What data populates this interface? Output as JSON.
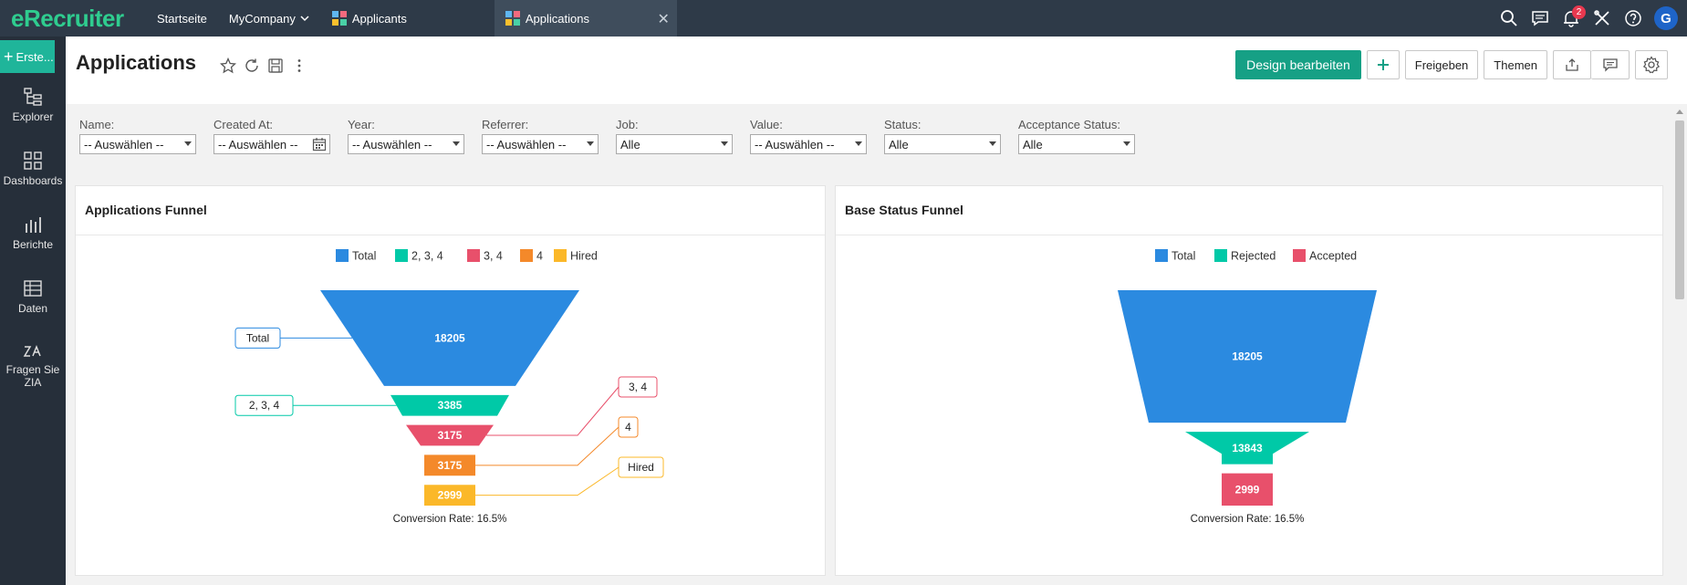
{
  "app": {
    "logo": "eRecruiter"
  },
  "topnav": {
    "home": "Startseite",
    "company": "MyCompany",
    "tabs": [
      {
        "label": "Applicants",
        "active": false
      },
      {
        "label": "Applications",
        "active": true
      }
    ],
    "notification_count": "2",
    "avatar_initial": "G"
  },
  "sidebar": {
    "create": "Erste...",
    "items": [
      {
        "label": "Explorer",
        "icon": "explorer-icon"
      },
      {
        "label": "Dashboards",
        "icon": "dashboards-icon"
      },
      {
        "label": "Berichte",
        "icon": "reports-icon"
      },
      {
        "label": "Daten",
        "icon": "data-table-icon"
      },
      {
        "label": "Fragen Sie ZIA",
        "icon": "zia-icon"
      }
    ]
  },
  "header": {
    "title": "Applications",
    "edit_design": "Design bearbeiten",
    "share": "Freigeben",
    "themes": "Themen"
  },
  "filters": [
    {
      "label": "Name:",
      "value": "-- Auswählen --"
    },
    {
      "label": "Created At:",
      "value": "-- Auswählen --"
    },
    {
      "label": "Year:",
      "value": "-- Auswählen --"
    },
    {
      "label": "Referrer:",
      "value": "-- Auswählen --"
    },
    {
      "label": "Job:",
      "value": "Alle"
    },
    {
      "label": "Value:",
      "value": "-- Auswählen --"
    },
    {
      "label": "Status:",
      "value": "Alle"
    },
    {
      "label": "Acceptance Status:",
      "value": "Alle"
    }
  ],
  "colors": {
    "blue": "#2b8ae0",
    "teal": "#00c9a7",
    "pink": "#e8506b",
    "orange": "#f4892a",
    "yellow": "#fbb829",
    "brand_green": "#2fcc8f",
    "primary_button": "#16a085"
  },
  "chart_data": [
    {
      "type": "funnel",
      "title": "Applications Funnel",
      "legend": [
        "Total",
        "2, 3, 4",
        "3, 4",
        "4",
        "Hired"
      ],
      "categories": [
        "Total",
        "2, 3, 4",
        "3, 4",
        "4",
        "Hired"
      ],
      "values": [
        18205,
        3385,
        3175,
        3175,
        2999
      ],
      "colors": [
        "#2b8ae0",
        "#00c9a7",
        "#e8506b",
        "#f4892a",
        "#fbb829"
      ],
      "conversion_rate": "Conversion Rate: 16.5%"
    },
    {
      "type": "funnel",
      "title": "Base Status Funnel",
      "legend": [
        "Total",
        "Rejected",
        "Accepted"
      ],
      "categories": [
        "Total",
        "Rejected",
        "Accepted"
      ],
      "values": [
        18205,
        13843,
        2999
      ],
      "colors": [
        "#2b8ae0",
        "#00c9a7",
        "#e8506b"
      ],
      "conversion_rate": "Conversion Rate: 16.5%"
    }
  ]
}
